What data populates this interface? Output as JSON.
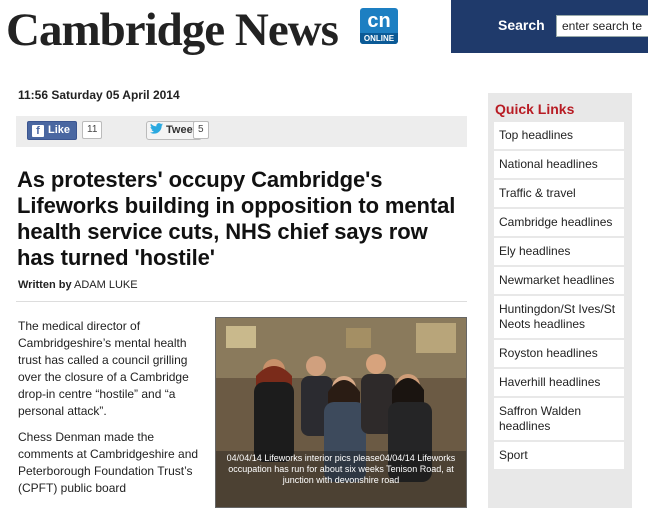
{
  "header": {
    "logo_text": "Cambridge News",
    "badge_main": "cn",
    "badge_sub": "ONLINE",
    "search_label": "Search",
    "search_value": "enter search te"
  },
  "article": {
    "dateline": "11:56 Saturday 05 April 2014",
    "social": {
      "like_label": "Like",
      "like_count": "11",
      "tweet_label": "Tweet",
      "tweet_count": "5"
    },
    "headline": "As protesters' occupy Cambridge's Lifeworks building in opposition to mental health service cuts, NHS chief says row has turned 'hostile'",
    "byline_label": "Written by",
    "byline_author": "ADAM LUKE",
    "paragraphs": [
      "The medical director of Cambridgeshire’s mental health trust has called a council grilling over the closure of a Cambridge drop-in centre “hostile” and “a personal attack”.",
      "Chess Denman made the comments at Cambridgeshire and Peterborough Foundation Trust’s (CPFT) public board"
    ],
    "photo_caption": "04/04/14 Lifeworks interior pics please04/04/14 Lifeworks occupation has run for about six weeks Tenison Road, at junction with devonshire road"
  },
  "quick_links": {
    "title": "Quick Links",
    "items": [
      "Top headlines",
      "National headlines",
      "Traffic & travel",
      "Cambridge headlines",
      "Ely headlines",
      "Newmarket headlines",
      "Huntingdon/St Ives/St Neots headlines",
      "Royston headlines",
      "Haverhill headlines",
      "Saffron Walden headlines",
      "Sport"
    ]
  },
  "colors": {
    "header_bar": "#1f3a6b",
    "quick_links_title": "#b81c24",
    "facebook": "#4a67a1",
    "twitter": "#2aa9e0"
  },
  "icons": [
    "facebook-icon",
    "twitter-bird-icon"
  ]
}
